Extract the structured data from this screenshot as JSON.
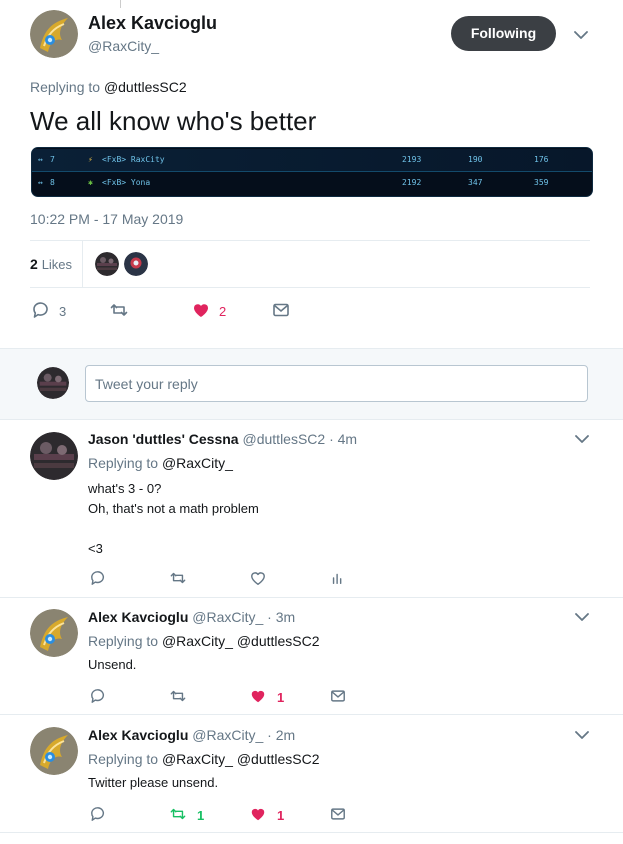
{
  "main_tweet": {
    "author_name": "Alex Kavcioglu",
    "handle": "@RaxCity_",
    "follow_label": "Following",
    "replying_prefix": "Replying to",
    "replying_to": "@duttlesSC2",
    "text": "We all know who's better",
    "timestamp": "10:22 PM - 17 May 2019",
    "likes_count": "2",
    "likes_label": "Likes",
    "actions": {
      "replies": "3",
      "likes": "2"
    }
  },
  "scoreboard": [
    {
      "rank": "7",
      "name": "<FxB> RaxCity",
      "score": "2193",
      "col2": "190",
      "col3": "176"
    },
    {
      "rank": "8",
      "name": "<FxB> Yona",
      "score": "2192",
      "col2": "347",
      "col3": "359"
    }
  ],
  "reply_box": {
    "placeholder": "Tweet your reply"
  },
  "replies": [
    {
      "author_name": "Jason 'duttles' Cessna",
      "meta": "@duttlesSC2 · 4m",
      "replying_prefix": "Replying to",
      "replying_to": "@RaxCity_",
      "lines": [
        "what's 3 - 0?",
        "Oh, that's not a math problem",
        "",
        "<3"
      ]
    },
    {
      "author_name": "Alex Kavcioglu",
      "meta": "@RaxCity_ · 3m",
      "replying_prefix": "Replying to",
      "replying_to": "@RaxCity_ @duttlesSC2",
      "lines": [
        "Unsend."
      ],
      "likes": "1"
    },
    {
      "author_name": "Alex Kavcioglu",
      "meta": "@RaxCity_ · 2m",
      "replying_prefix": "Replying to",
      "replying_to": "@RaxCity_ @duttlesSC2",
      "lines": [
        "Twitter please unsend."
      ],
      "retweets": "1",
      "likes": "1"
    }
  ],
  "colors": {
    "accent": "#1da1f2",
    "like": "#e0245e",
    "retweet": "#17bf63",
    "muted": "#657786"
  }
}
